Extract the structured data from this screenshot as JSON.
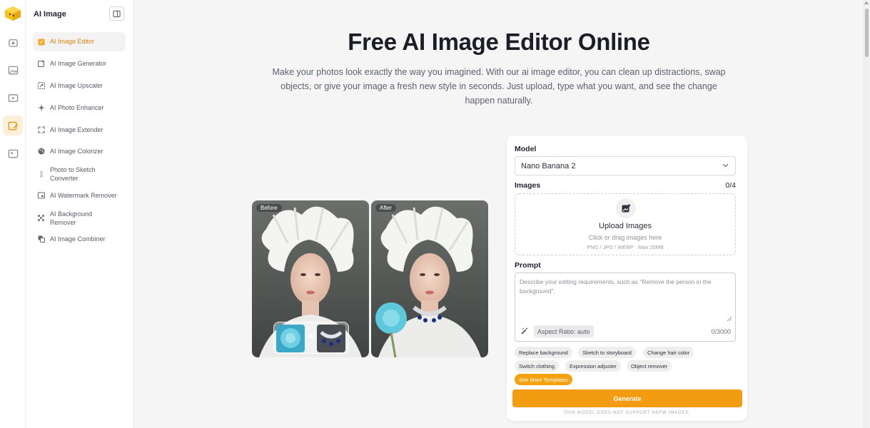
{
  "app": {
    "section_title": "AI Image"
  },
  "sidebar": {
    "items": [
      {
        "label": "AI Image Editor",
        "icon": "edit-image-icon",
        "active": true
      },
      {
        "label": "AI Image Generator",
        "icon": "sparkle-image-icon"
      },
      {
        "label": "AI Image Upscaler",
        "icon": "upscale-icon"
      },
      {
        "label": "AI Photo Enhancer",
        "icon": "enhance-icon"
      },
      {
        "label": "AI Image Extender",
        "icon": "expand-icon"
      },
      {
        "label": "AI Image Colorizer",
        "icon": "palette-icon"
      },
      {
        "label": "Photo to Sketch Converter",
        "icon": "pencil-icon"
      },
      {
        "label": "AI Watermark Remover",
        "icon": "watermark-icon"
      },
      {
        "label": "AI Background Remover",
        "icon": "background-remove-icon"
      },
      {
        "label": "AI Image Combiner",
        "icon": "combine-icon"
      }
    ]
  },
  "hero": {
    "title": "Free AI Image Editor Online",
    "subtitle": "Make your photos look exactly the way you imagined. With our ai image editor, you can clean up distractions, swap objects, or give your image a fresh new style in seconds. Just upload, type what you want, and see the change happen naturally."
  },
  "preview": {
    "before_label": "Before",
    "after_label": "After"
  },
  "panel": {
    "model_label": "Model",
    "model_value": "Nano Banana 2",
    "images_label": "Images",
    "images_count": "0/4",
    "upload_title": "Upload Images",
    "upload_hint": "Click or drag images here",
    "upload_formats": "PNG / JPG / WEBP · Max 20MB",
    "prompt_label": "Prompt",
    "prompt_placeholder": "Describe your editing requirements, such as \"Remove the person in the background\".",
    "aspect_ratio": "Aspect Ratio: auto",
    "prompt_count": "0/3000",
    "templates": [
      "Replace background",
      "Sketch to storyboard",
      "Change hair color",
      "Switch clothing",
      "Expression adjuster",
      "Object remover"
    ],
    "more_templates": "See More Templates",
    "generate": "Generate",
    "nsfw_notice": "THIS MODEL DOES NOT SUPPORT NSFW IMAGES."
  },
  "colors": {
    "accent": "#f39c12",
    "active_text": "#e0820f",
    "background": "#f5f5f5"
  }
}
